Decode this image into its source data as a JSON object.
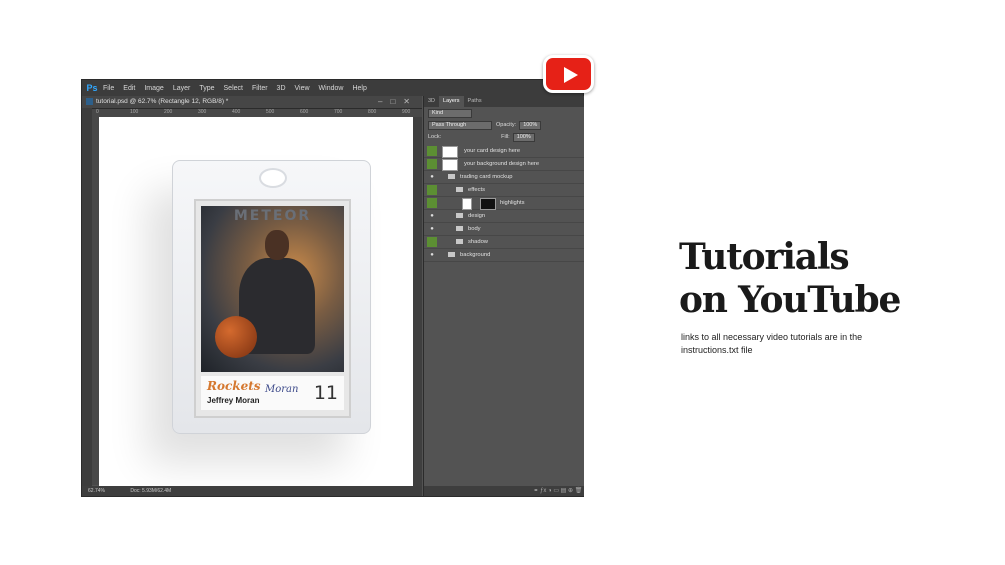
{
  "app": {
    "menu": [
      "File",
      "Edit",
      "Image",
      "Layer",
      "Type",
      "Select",
      "Filter",
      "3D",
      "View",
      "Window",
      "Help"
    ],
    "logo": "Ps",
    "document_tab": "tutorial.psd @ 62.7% (Rectangle 12, RGB/8) *",
    "ruler_marks": [
      "0",
      "100",
      "200",
      "300",
      "400",
      "500",
      "600",
      "700",
      "800",
      "900"
    ],
    "status": {
      "zoom": "62.74%",
      "doc": "Doc: 5.93M/62.4M"
    }
  },
  "card": {
    "brand": "METEOR",
    "team": "Rockets",
    "player": "Jeffrey Moran",
    "signature": "Moran",
    "number": "11"
  },
  "panel": {
    "tabs": [
      "3D",
      "Layers",
      "Paths"
    ],
    "filter": "Kind",
    "blend_mode": "Pass Through",
    "opacity_label": "Opacity:",
    "opacity": "100%",
    "lock_label": "Lock:",
    "fill_label": "Fill:",
    "fill": "100%",
    "layers": [
      {
        "name": "your card design here"
      },
      {
        "name": "your background design here"
      },
      {
        "name": "trading card mockup"
      },
      {
        "name": "effects"
      },
      {
        "name": "highlights"
      },
      {
        "name": "design"
      },
      {
        "name": "body"
      },
      {
        "name": "shadow"
      },
      {
        "name": "background"
      }
    ]
  },
  "promo": {
    "headline_1": "Tutorials",
    "headline_2": "on YouTube",
    "description": "links to all necessary video tutorials are in the instructions.txt file"
  },
  "colors": {
    "youtube_red": "#e62117",
    "visibility_green": "#5c8f33",
    "ps_blue": "#31a8ff"
  }
}
